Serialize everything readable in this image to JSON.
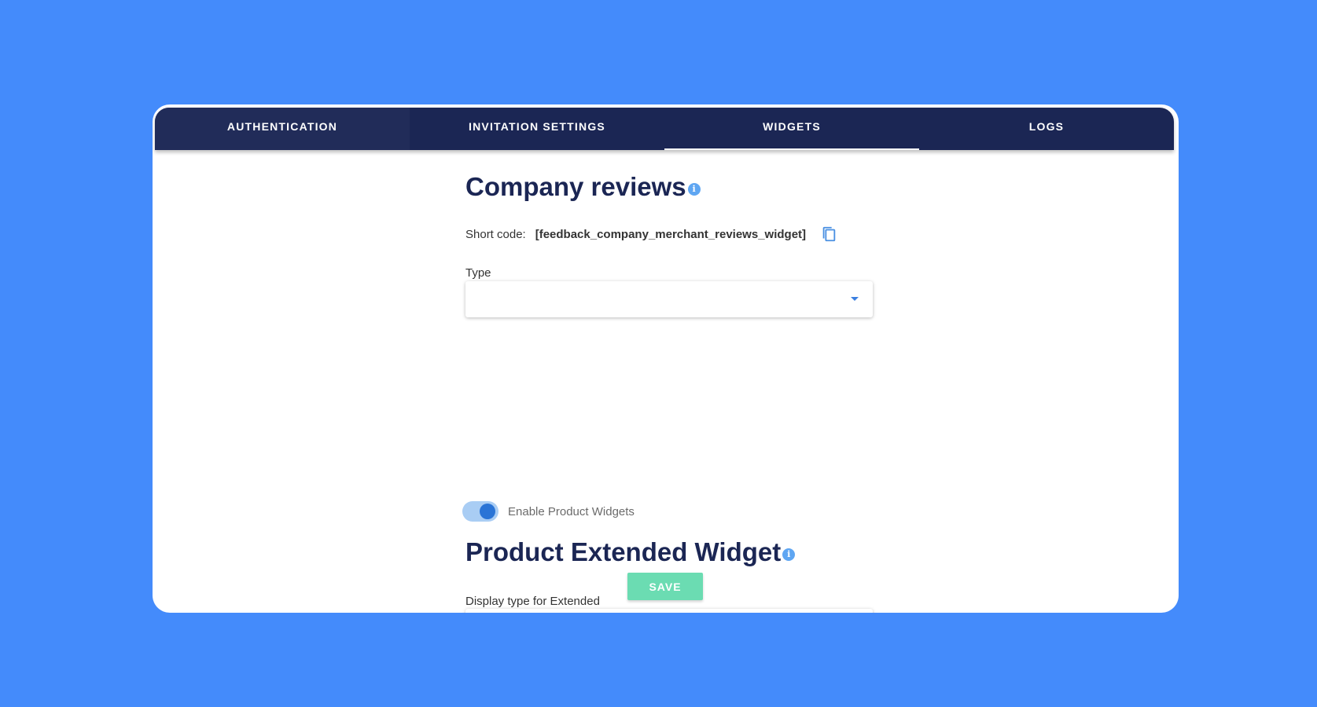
{
  "tabs": [
    {
      "label": "AUTHENTICATION"
    },
    {
      "label": "INVITATION SETTINGS"
    },
    {
      "label": "WIDGETS"
    },
    {
      "label": "LOGS"
    }
  ],
  "active_tab": "WIDGETS",
  "company_reviews": {
    "title": "Company reviews",
    "info_icon": "info-icon",
    "shortcode_label": "Short code:",
    "shortcode_value": "[feedback_company_merchant_reviews_widget]",
    "copy_icon": "copy-icon",
    "type_label": "Type",
    "type_value": ""
  },
  "product_widgets": {
    "toggle_label": "Enable Product Widgets",
    "toggle_on": true
  },
  "product_extended": {
    "title": "Product Extended Widget",
    "info_icon": "info-icon",
    "display_type_label": "Display type for Extended",
    "display_type_value": ""
  },
  "save_label": "SAVE",
  "colors": {
    "background": "#448bfb",
    "nav": "#1b2654",
    "heading": "#1b2654",
    "accent": "#2a74d6",
    "save_button": "#6bdcb2"
  }
}
